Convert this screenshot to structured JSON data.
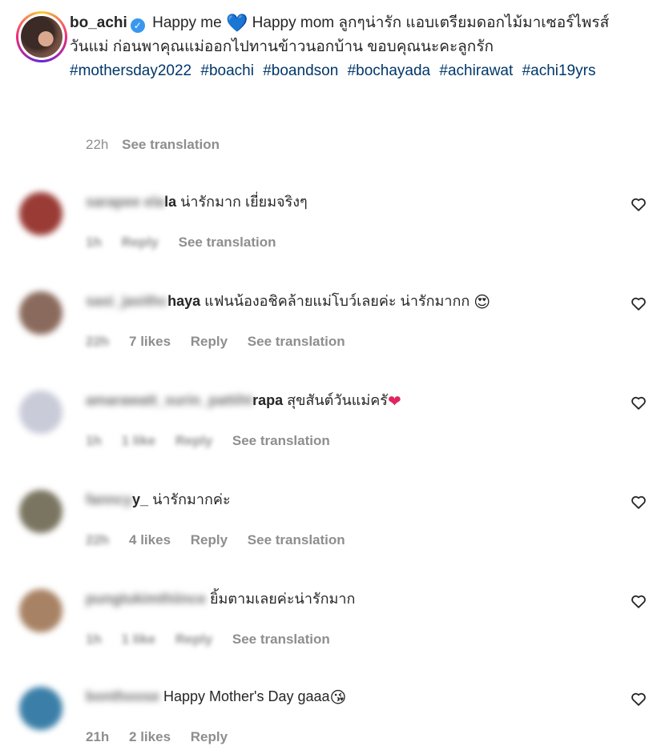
{
  "post": {
    "username": "bo_achi",
    "verified_mark": "✓",
    "caption_lead": "Happy me",
    "caption_heart": "💙",
    "caption_body": "Happy mom ลูกๆน่ารัก แอบเตรียมดอกไม้มาเซอร์ไพรส์วันแม่ ก่อนพาคุณแม่ออกไปทานข้าวนอกบ้าน ขอบคุณนะคะลูกรัก",
    "hashtags": [
      "#mothersday2022",
      "#boachi",
      "#boandson",
      "#bochayada",
      "#achirawat",
      "#achi19yrs"
    ],
    "time": "22h",
    "see_translation": "See translation"
  },
  "comments": [
    {
      "name_blurred": "sarapee ela",
      "name_visible": "la",
      "text": " น่ารักมาก เยี่ยมจริงๆ",
      "emoji": "",
      "time_blurred": "1h",
      "likes": "",
      "reply": "Reply",
      "see_translation": "See translation",
      "avatar_color": "#9a3b35"
    },
    {
      "name_blurred": "sasi_jasithc",
      "name_visible": "haya",
      "text": " แฟนน้องอชิคล้ายแม่โบว์เลยค่ะ น่ารักมากก",
      "emoji": "😍",
      "time_blurred": "22h",
      "likes": "7 likes",
      "reply": "Reply",
      "see_translation": "See translation",
      "avatar_color": "#8a6a5c"
    },
    {
      "name_blurred": "amarawatt_surin_pattiht",
      "name_visible": "rapa",
      "text": " สุขสันต์วันแม่ครั",
      "emoji": "❤",
      "time_blurred": "1h",
      "likes": "1 like",
      "reply": "Reply",
      "see_translation": "See translation",
      "avatar_color": "#c9cbd9"
    },
    {
      "name_blurred": "fanncy",
      "name_visible": "y_",
      "text": " น่ารักมากค่ะ",
      "emoji": "",
      "time_blurred": "22h",
      "likes": "4 likes",
      "reply": "Reply",
      "see_translation": "See translation",
      "avatar_color": "#7a7560"
    },
    {
      "name_blurred": "pungtukimthiince",
      "name_visible": "",
      "text": " ยิ้มตามเลยค่ะน่ารักมาก",
      "emoji": "",
      "time_blurred": "1h",
      "likes": "1 like",
      "reply": "Reply",
      "see_translation": "See translation",
      "avatar_color": "#a88264"
    },
    {
      "name_blurred": "bonthoose",
      "name_visible": "",
      "text": " Happy Mother's Day gaaa",
      "emoji": "😘",
      "time_blurred": "",
      "time": "21h",
      "likes": "2 likes",
      "reply": "Reply",
      "see_translation": "",
      "avatar_color": "#3b7fa8"
    }
  ],
  "icons": {
    "like": "heart-outline-icon"
  }
}
